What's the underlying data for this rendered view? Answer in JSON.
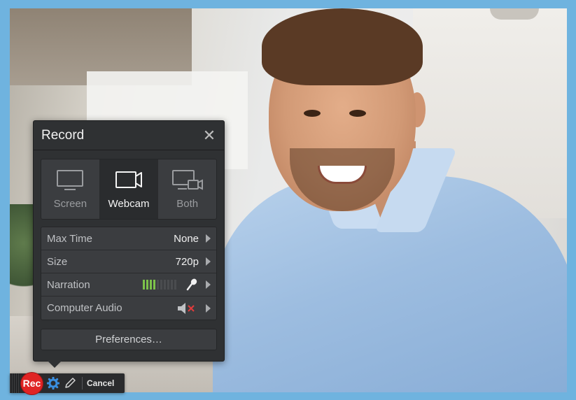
{
  "panel": {
    "title": "Record",
    "modes": [
      {
        "label": "Screen",
        "icon": "monitor-icon",
        "active": false
      },
      {
        "label": "Webcam",
        "icon": "webcam-icon",
        "active": true
      },
      {
        "label": "Both",
        "icon": "monitor-webcam-icon",
        "active": false
      }
    ],
    "settings": {
      "max_time": {
        "label": "Max Time",
        "value": "None"
      },
      "size": {
        "label": "Size",
        "value": "720p"
      },
      "narration": {
        "label": "Narration",
        "level": 0.4
      },
      "computer_audio": {
        "label": "Computer Audio",
        "muted": true
      }
    },
    "preferences_label": "Preferences…"
  },
  "toolbar": {
    "rec_label": "Rec",
    "cancel_label": "Cancel"
  },
  "colors": {
    "accent_rec": "#e02424",
    "meter_on": "#7cc24a",
    "gear": "#3a8fe0",
    "mute_x": "#e23b3b"
  }
}
